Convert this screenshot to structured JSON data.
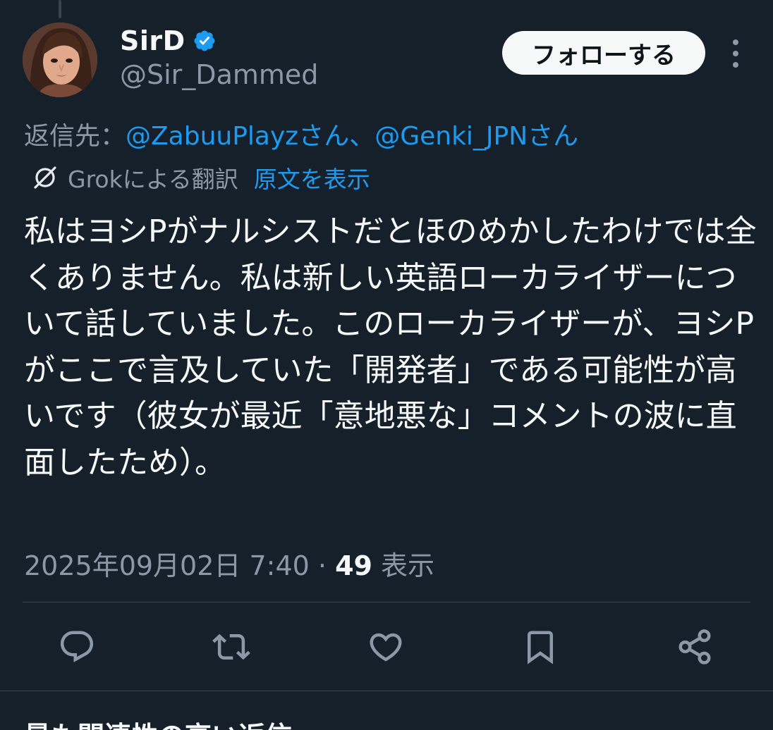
{
  "author": {
    "display_name": "SirD",
    "handle": "@Sir_Dammed",
    "verified_icon": "verified-badge-icon",
    "avatar_icon": "avatar"
  },
  "header": {
    "follow_label": "フォローする",
    "more_icon": "more-options-icon"
  },
  "reply_to": {
    "prefix": "返信先：",
    "mention_1": "@ZabuuPlayzさん",
    "separator": "、",
    "mention_2": "@Genki_JPNさん"
  },
  "translation": {
    "icon": "grok-icon",
    "label": "Grokによる翻訳",
    "show_original": "原文を表示"
  },
  "tweet": {
    "text": "私はヨシPがナルシストだとほのめかしたわけでは全くありません。私は新しい英語ローカライザーについて話していました。このローカライザーが、ヨシPがここで言及していた「開発者」である可能性が高いです（彼女が最近「意地悪な」コメントの波に直面したため）。"
  },
  "meta": {
    "timestamp": "2025年09月02日 7:40",
    "dot": " · ",
    "views_count": "49",
    "views_label": " 表示"
  },
  "actions": {
    "reply_icon": "reply-icon",
    "retweet_icon": "retweet-icon",
    "like_icon": "like-icon",
    "bookmark_icon": "bookmark-icon",
    "share_icon": "share-icon"
  },
  "next_section": {
    "title": "最も関連性の高い返信"
  },
  "colors": {
    "background": "#15202b",
    "accent": "#1d9bf0",
    "secondary_text": "#8b98a5",
    "divider": "#38444d"
  }
}
